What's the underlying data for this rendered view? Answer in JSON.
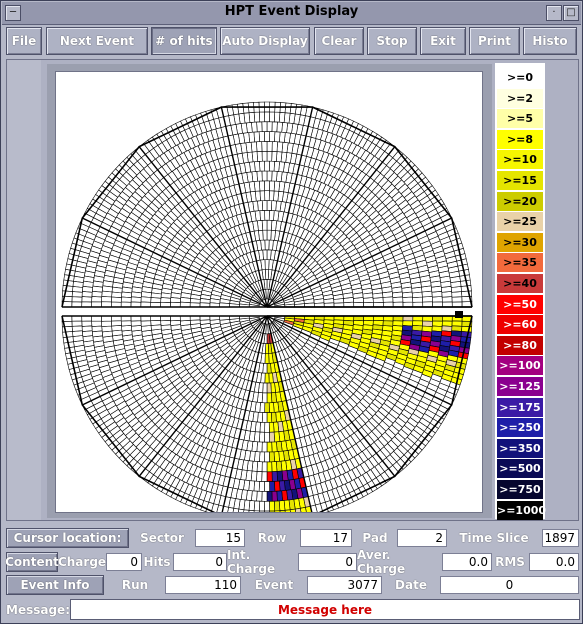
{
  "window": {
    "title": "HPT Event Display"
  },
  "menu": {
    "items": [
      {
        "label": "File",
        "name": "file-button"
      },
      {
        "label": "Next Event",
        "name": "next-event-button"
      },
      {
        "label": "# of hits",
        "name": "hits-button"
      },
      {
        "label": "Auto Display",
        "name": "auto-display-button"
      },
      {
        "label": "Clear",
        "name": "clear-button"
      },
      {
        "label": "Stop",
        "name": "stop-button"
      },
      {
        "label": "Exit",
        "name": "exit-button"
      },
      {
        "label": "Print",
        "name": "print-button"
      },
      {
        "label": "Histo",
        "name": "histo-button"
      }
    ]
  },
  "legend": [
    {
      "label": ">=0",
      "bg": "#ffffff",
      "fg": "#000000"
    },
    {
      "label": ">=2",
      "bg": "#ffffe0",
      "fg": "#000000"
    },
    {
      "label": ">=5",
      "bg": "#ffffa8",
      "fg": "#000000"
    },
    {
      "label": ">=8",
      "bg": "#ffff00",
      "fg": "#000000"
    },
    {
      "label": ">=10",
      "bg": "#f6f600",
      "fg": "#000000"
    },
    {
      "label": ">=15",
      "bg": "#e5e500",
      "fg": "#000000"
    },
    {
      "label": ">=20",
      "bg": "#cccc00",
      "fg": "#000000"
    },
    {
      "label": ">=25",
      "bg": "#e9d2a8",
      "fg": "#000000"
    },
    {
      "label": ">=30",
      "bg": "#dfa400",
      "fg": "#000000"
    },
    {
      "label": ">=35",
      "bg": "#f26a3c",
      "fg": "#000000"
    },
    {
      "label": ">=40",
      "bg": "#c93a3a",
      "fg": "#000000"
    },
    {
      "label": ">=50",
      "bg": "#ff0000",
      "fg": "#ffffff"
    },
    {
      "label": ">=60",
      "bg": "#ee0000",
      "fg": "#ffffff"
    },
    {
      "label": ">=80",
      "bg": "#c20000",
      "fg": "#ffffff"
    },
    {
      "label": ">=100",
      "bg": "#a30080",
      "fg": "#ffffff"
    },
    {
      "label": ">=125",
      "bg": "#8a008f",
      "fg": "#ffffff"
    },
    {
      "label": ">=175",
      "bg": "#3a1aa5",
      "fg": "#ffffff"
    },
    {
      "label": ">=250",
      "bg": "#1e1ea8",
      "fg": "#ffffff"
    },
    {
      "label": ">=350",
      "bg": "#12127a",
      "fg": "#ffffff"
    },
    {
      "label": ">=500",
      "bg": "#0a0a55",
      "fg": "#ffffff"
    },
    {
      "label": ">=750",
      "bg": "#06062e",
      "fg": "#ffffff"
    },
    {
      "label": ">=1000",
      "bg": "#000000",
      "fg": "#ffffff"
    }
  ],
  "cursor_row": {
    "button": "Cursor location:",
    "sector_label": "Sector",
    "sector": "15",
    "row_label": "Row",
    "row": "17",
    "pad_label": "Pad",
    "pad": "2",
    "slice_label": "Time Slice",
    "slice": "1897"
  },
  "content_row": {
    "button": "Content",
    "charge_label": "Charge",
    "charge": "0",
    "hits_label": "Hits",
    "hits": "0",
    "int_label": "Int. Charge",
    "int_charge": "0",
    "aver_label": "Aver. Charge",
    "aver": "0.0",
    "rms_label": "RMS",
    "rms": "0.0"
  },
  "event_row": {
    "button": "Event Info",
    "run_label": "Run",
    "run": "110",
    "event_label": "Event",
    "event": "3077",
    "date_label": "Date",
    "date": "0"
  },
  "message": {
    "label": "Message:",
    "text": "Message here"
  },
  "colors": {
    "window_bg": "#b5b8c8",
    "message_text": "#d10000"
  }
}
